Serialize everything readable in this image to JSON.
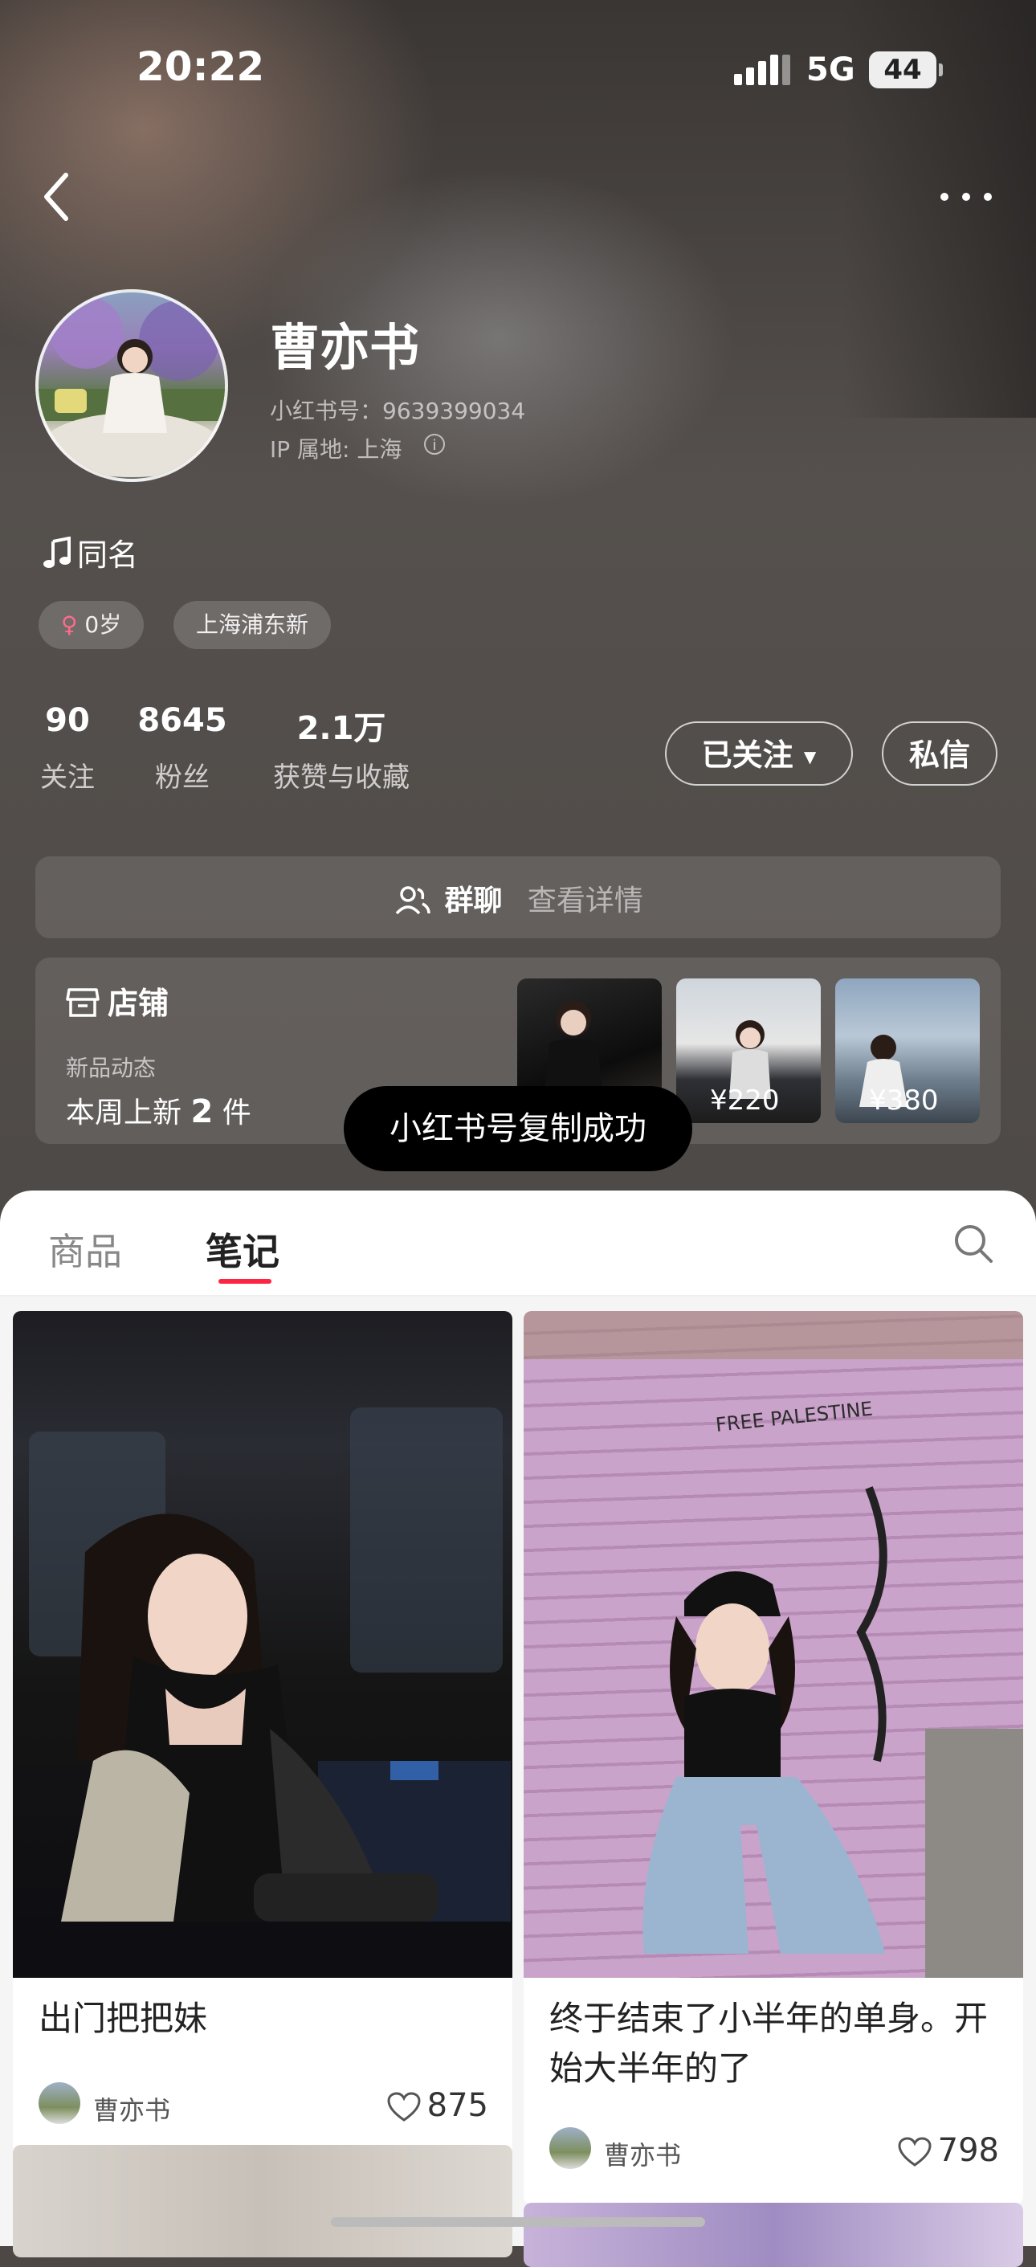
{
  "status_bar": {
    "time": "20:22",
    "network": "5G",
    "battery": "44"
  },
  "profile": {
    "name": "曹亦书",
    "red_id": "小红书号：9639399034",
    "ip_location": "IP 属地: 上海",
    "bio": "同名",
    "tags": [
      "0岁",
      "上海浦东新"
    ]
  },
  "stats": [
    {
      "value": "90",
      "label": "关注"
    },
    {
      "value": "8645",
      "label": "粉丝"
    },
    {
      "value": "2.1万",
      "label": "获赞与收藏"
    }
  ],
  "actions": {
    "followed": "已关注",
    "message": "私信"
  },
  "group_chat": {
    "label": "群聊",
    "detail": "查看详情"
  },
  "shop": {
    "title": "店铺",
    "subtitle": "新品动态",
    "new_this_week": "本周上新",
    "new_count": "2",
    "new_unit": "件",
    "prices": [
      "",
      "¥220",
      "¥380"
    ]
  },
  "toast": "小红书号复制成功",
  "tabs": [
    "商品",
    "笔记"
  ],
  "active_tab": "笔记",
  "notes": [
    {
      "title": "出门把把妹",
      "author": "曹亦书",
      "likes": "875"
    },
    {
      "title": "终于结束了小半年的单身。开始大半年的了",
      "author": "曹亦书",
      "likes": "798"
    }
  ],
  "colors": {
    "accent": "#ff2442",
    "hero_bg": "#4d4845",
    "toast_bg": "#000000"
  }
}
